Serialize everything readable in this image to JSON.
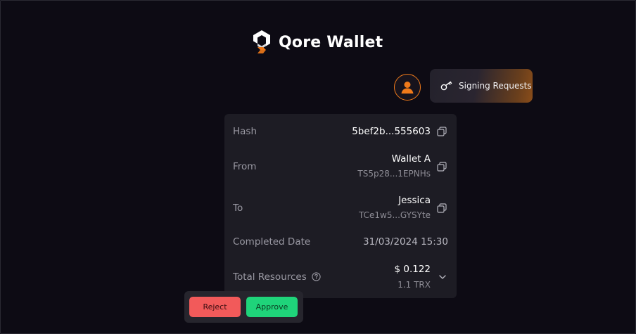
{
  "app": {
    "name": "Qore Wallet",
    "colors": {
      "accent": "#f07a1a",
      "approve": "#1fd47a",
      "reject": "#f25a5a"
    }
  },
  "header": {
    "signing_requests_label": "Signing Requests",
    "avatar_icon": "user-icon",
    "signing_icon": "key-icon"
  },
  "details": {
    "hash": {
      "label": "Hash",
      "value": "5bef2b...555603"
    },
    "from": {
      "label": "From",
      "name": "Wallet A",
      "address": "TS5p28...1EPNHs"
    },
    "to": {
      "label": "To",
      "name": "Jessica",
      "address": "TCe1w5...GYSYte"
    },
    "completed_date": {
      "label": "Completed Date",
      "value": "31/03/2024 15:30"
    },
    "total_resources": {
      "label": "Total Resources",
      "value": "$ 0.122",
      "sub": "1.1 TRX"
    }
  },
  "actions": {
    "reject_label": "Reject",
    "approve_label": "Approve"
  }
}
